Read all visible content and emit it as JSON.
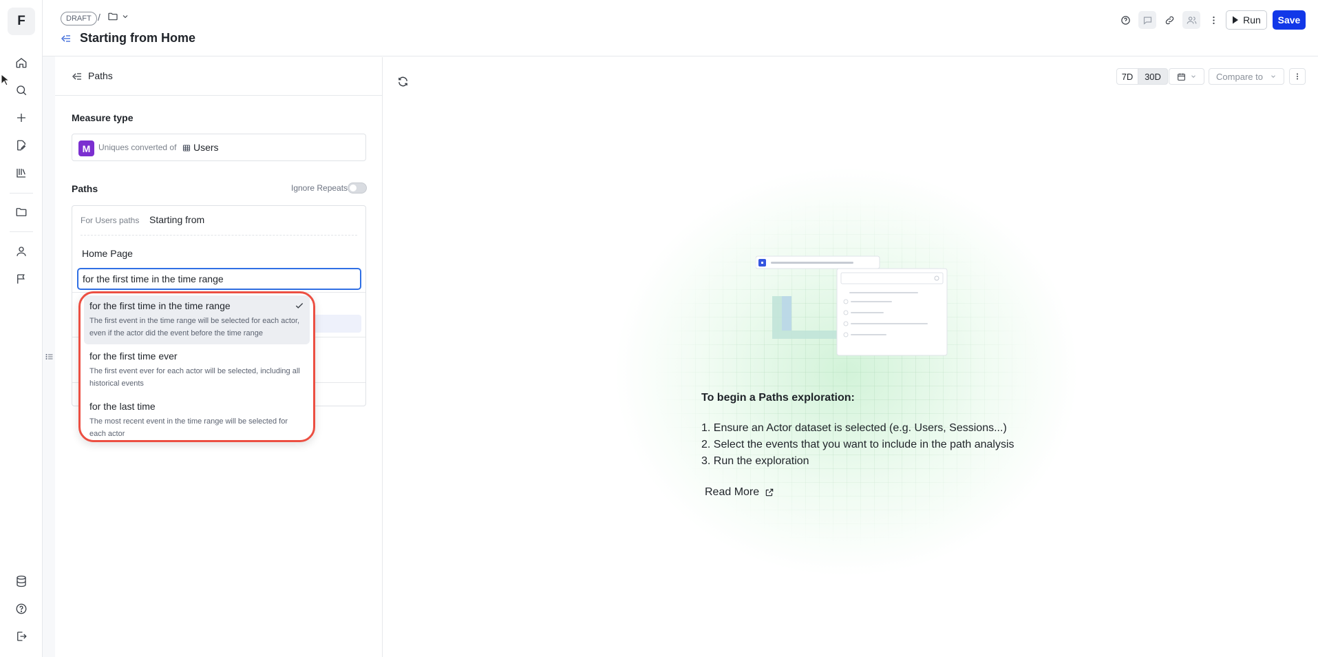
{
  "app": {
    "logo_letter": "F"
  },
  "header": {
    "status_badge": "DRAFT",
    "separator": "/",
    "title": "Starting from Home",
    "run_label": "Run",
    "save_label": "Save"
  },
  "panel": {
    "header_label": "Paths",
    "measure_type": {
      "title": "Measure type",
      "badge": "M",
      "prefix": "Uniques converted of",
      "dataset": "Users"
    },
    "paths": {
      "title": "Paths",
      "ignore_repeats_label": "Ignore Repeats",
      "ignore_repeats_on": false,
      "for_label": "For Users paths",
      "mode": "Starting from",
      "event": "Home Page",
      "time_value": "for the first time in the time range"
    }
  },
  "dropdown": {
    "options": [
      {
        "title": "for the first time in the time range",
        "description": "The first event in the time range will be selected for each actor, even if the actor did the event before the time range",
        "selected": true
      },
      {
        "title": "for the first time ever",
        "description": "The first event ever for each actor will be selected, including all historical events",
        "selected": false
      },
      {
        "title": "for the last time",
        "description": "The most recent event in the time range will be selected for each actor",
        "selected": false
      }
    ]
  },
  "toolbar": {
    "range_7d": "7D",
    "range_30d": "30D",
    "compare_label": "Compare to"
  },
  "empty_state": {
    "heading": "To begin a Paths exploration:",
    "steps": [
      "1. Ensure an Actor dataset is selected (e.g. Users, Sessions...)",
      "2. Select the events that you want to include in the path analysis",
      "3. Run the exploration"
    ],
    "read_more": "Read More"
  },
  "colors": {
    "accent": "#1238e8",
    "focus": "#2f6fe4",
    "measure_badge": "#7b2fd0",
    "dropdown_highlight": "#ec4f42"
  }
}
